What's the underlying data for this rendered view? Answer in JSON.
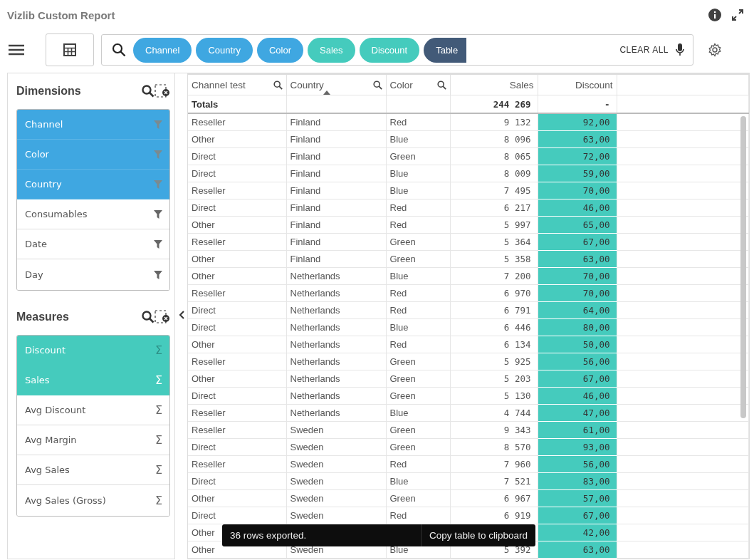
{
  "window": {
    "title": "Vizlib Custom Report"
  },
  "selection_bar": {
    "chips": [
      {
        "label": "Channel",
        "kind": "dimension"
      },
      {
        "label": "Country",
        "kind": "dimension"
      },
      {
        "label": "Color",
        "kind": "dimension"
      },
      {
        "label": "Sales",
        "kind": "measure"
      },
      {
        "label": "Discount",
        "kind": "measure"
      },
      {
        "label": "Table",
        "kind": "chart"
      }
    ],
    "clear_all": "CLEAR ALL"
  },
  "sidebar": {
    "dimensions": {
      "title": "Dimensions",
      "items": [
        {
          "label": "Channel",
          "selected": true
        },
        {
          "label": "Color",
          "selected": true
        },
        {
          "label": "Country",
          "selected": true
        },
        {
          "label": "Consumables",
          "selected": false
        },
        {
          "label": "Date",
          "selected": false
        },
        {
          "label": "Day",
          "selected": false
        }
      ]
    },
    "measures": {
      "title": "Measures",
      "items": [
        {
          "label": "Discount",
          "selected": true,
          "icon": "Σ"
        },
        {
          "label": "Sales",
          "selected": true,
          "icon": "Σ"
        },
        {
          "label": "Avg Discount",
          "selected": false,
          "icon": "Σ"
        },
        {
          "label": "Avg Margin",
          "selected": false,
          "icon": "Σ"
        },
        {
          "label": "Avg Sales",
          "selected": false,
          "icon": "Σ"
        },
        {
          "label": "Avg Sales (Gross)",
          "selected": false,
          "icon": "Σ"
        }
      ]
    }
  },
  "table": {
    "columns": [
      {
        "label": "Channel test",
        "kind": "dimension",
        "searchable": true,
        "sorted": false,
        "highlighted": false
      },
      {
        "label": "Country",
        "kind": "dimension",
        "searchable": true,
        "sorted": true,
        "highlighted": false
      },
      {
        "label": "Color",
        "kind": "dimension",
        "searchable": true,
        "sorted": false,
        "highlighted": false
      },
      {
        "label": "Sales",
        "kind": "measure",
        "searchable": false,
        "sorted": false,
        "highlighted": false
      },
      {
        "label": "Discount",
        "kind": "measure",
        "searchable": false,
        "sorted": false,
        "highlighted": true
      }
    ],
    "totals": {
      "label": "Totals",
      "sales": "244 269",
      "discount": "-"
    },
    "rows": [
      [
        "Reseller",
        "Finland",
        "Red",
        "9 132",
        "92,00"
      ],
      [
        "Other",
        "Finland",
        "Blue",
        "8 096",
        "63,00"
      ],
      [
        "Direct",
        "Finland",
        "Green",
        "8 065",
        "72,00"
      ],
      [
        "Direct",
        "Finland",
        "Blue",
        "8 009",
        "59,00"
      ],
      [
        "Reseller",
        "Finland",
        "Blue",
        "7 495",
        "70,00"
      ],
      [
        "Direct",
        "Finland",
        "Red",
        "6 217",
        "46,00"
      ],
      [
        "Other",
        "Finland",
        "Red",
        "5 997",
        "65,00"
      ],
      [
        "Reseller",
        "Finland",
        "Green",
        "5 364",
        "67,00"
      ],
      [
        "Other",
        "Finland",
        "Green",
        "5 358",
        "63,00"
      ],
      [
        "Other",
        "Netherlands",
        "Blue",
        "7 200",
        "70,00"
      ],
      [
        "Reseller",
        "Netherlands",
        "Red",
        "6 970",
        "70,00"
      ],
      [
        "Direct",
        "Netherlands",
        "Red",
        "6 791",
        "64,00"
      ],
      [
        "Direct",
        "Netherlands",
        "Blue",
        "6 446",
        "80,00"
      ],
      [
        "Other",
        "Netherlands",
        "Red",
        "6 134",
        "50,00"
      ],
      [
        "Reseller",
        "Netherlands",
        "Green",
        "5 925",
        "56,00"
      ],
      [
        "Other",
        "Netherlands",
        "Green",
        "5 203",
        "67,00"
      ],
      [
        "Direct",
        "Netherlands",
        "Green",
        "5 130",
        "46,00"
      ],
      [
        "Reseller",
        "Netherlands",
        "Blue",
        "4 744",
        "47,00"
      ],
      [
        "Reseller",
        "Sweden",
        "Green",
        "9 343",
        "61,00"
      ],
      [
        "Direct",
        "Sweden",
        "Green",
        "8 570",
        "93,00"
      ],
      [
        "Reseller",
        "Sweden",
        "Red",
        "7 960",
        "56,00"
      ],
      [
        "Direct",
        "Sweden",
        "Blue",
        "7 521",
        "83,00"
      ],
      [
        "Other",
        "Sweden",
        "Green",
        "6 967",
        "57,00"
      ],
      [
        "Direct",
        "Sweden",
        "Red",
        "6 919",
        "67,00"
      ],
      [
        "Other",
        null,
        null,
        null,
        "42,00"
      ],
      [
        "Other",
        "Sweden",
        "Blue",
        "5 392",
        "63,00"
      ]
    ]
  },
  "toast": {
    "message": "36 rows exported.",
    "action": "Copy table to clipboard"
  }
}
